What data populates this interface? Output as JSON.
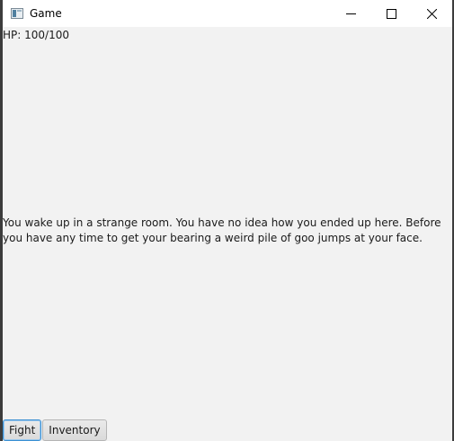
{
  "window": {
    "title": "Game",
    "icon": "java-app-icon",
    "controls": [
      "minimize-icon",
      "maximize-icon",
      "close-icon"
    ]
  },
  "status": {
    "hp": "HP: 100/100"
  },
  "story": {
    "text": "You wake up in a strange room. You have no idea how you ended up here. Before you have any time to get your bearing a weird pile of goo jumps at your face."
  },
  "actions": {
    "fight_label": "Fight",
    "inventory_label": "Inventory"
  }
}
